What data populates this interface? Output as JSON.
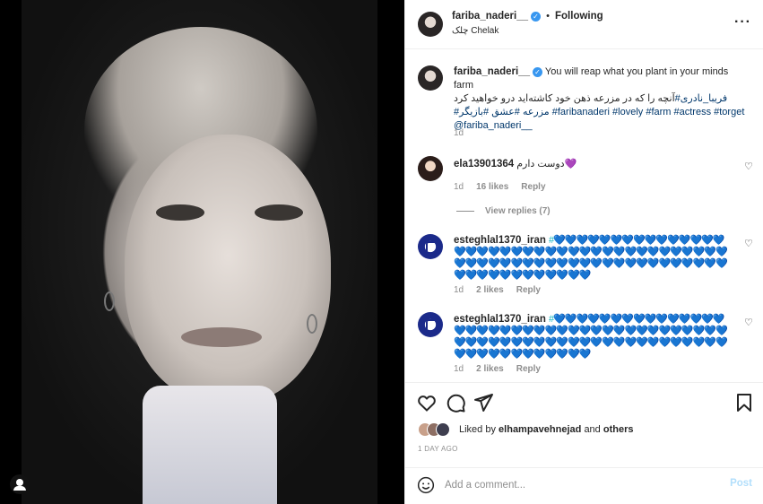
{
  "header": {
    "username": "fariba_naderi__",
    "follow_label": "Following",
    "location": "چلک Chelak"
  },
  "caption": {
    "username": "fariba_naderi__",
    "text_en": "You will reap what you plant in your minds farm",
    "text_fa": "آنچه را که در مزرعه ذهن خود کاشته‌اید درو خواهید کرد",
    "tags_line1": "#فریبا_نادری",
    "tags_line2": "#مزرعه #عشق #بازیگر #faribanaderi #lovely #farm #actress #torget",
    "mention": "@fariba_naderi__",
    "time": "1d"
  },
  "comments": [
    {
      "username": "ela13901364",
      "text": "دوست دارم💜",
      "time": "1d",
      "likes": "16 likes",
      "reply_label": "Reply",
      "view_replies": "View replies (7)"
    },
    {
      "username": "esteghlal1370_iran",
      "text": "#💙💙💙💙💙💙💙💙💙💙💙💙💙💙💙💙💙💙💙💙💙💙💙💙💙💙💙💙💙💙💙💙💙💙💙💙💙💙💙💙💙💙💙💙💙💙💙💙💙💙💙💙💙💙💙💙💙💙💙💙💙💙💙💙💙💙💙💙💙💙💙💙💙💙💙",
      "time": "1d",
      "likes": "2 likes",
      "reply_label": "Reply"
    },
    {
      "username": "esteghlal1370_iran",
      "text": "#💙💙💙💙💙💙💙💙💙💙💙💙💙💙💙💙💙💙💙💙💙💙💙💙💙💙💙💙💙💙💙💙💙💙💙💙💙💙💙💙💙💙💙💙💙💙💙💙💙💙💙💙💙💙💙💙💙💙💙💙💙💙💙💙💙💙💙💙💙💙💙💙💙💙💙",
      "time": "1d",
      "likes": "2 likes",
      "reply_label": "Reply"
    }
  ],
  "likes": {
    "prefix": "Liked by",
    "user": "elhampavehnejad",
    "connector": "and",
    "others": "others"
  },
  "post_age": "1 DAY AGO",
  "add_comment": {
    "placeholder": "Add a comment...",
    "post_label": "Post"
  },
  "colors": {
    "accent": "#0095f6",
    "link": "#00376b",
    "muted": "#8e8e8e",
    "heart_teal": "#18b7c4"
  },
  "icons": [
    "more-icon",
    "verified-icon",
    "heart-icon",
    "comment-icon",
    "share-icon",
    "save-icon",
    "emoji-icon",
    "user-tag-icon"
  ]
}
